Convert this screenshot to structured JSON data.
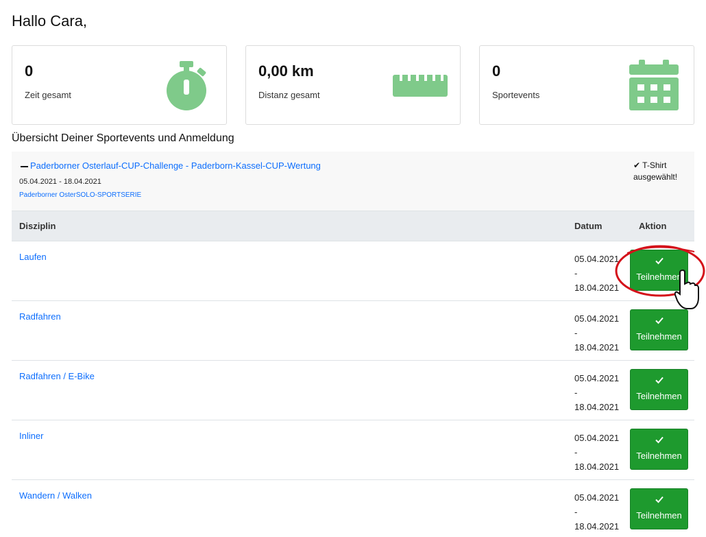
{
  "greeting": "Hallo Cara,",
  "stats": [
    {
      "value": "0",
      "label": "Zeit gesamt",
      "icon": "stopwatch-icon"
    },
    {
      "value": "0,00 km",
      "label": "Distanz gesamt",
      "icon": "ruler-icon"
    },
    {
      "value": "0",
      "label": "Sportevents",
      "icon": "calendar-icon"
    }
  ],
  "section_title": "Übersicht Deiner Sportevents und Anmeldung",
  "event": {
    "title": "Paderborner Osterlauf-CUP-Challenge - Paderborn-Kassel-CUP-Wertung",
    "dates": "05.04.2021 - 18.04.2021",
    "series": "Paderborner OsterSOLO-SPORTSERIE",
    "tshirt_line1": "✔ T-Shirt",
    "tshirt_line2": "ausgewählt!"
  },
  "table": {
    "headers": {
      "disziplin": "Disziplin",
      "datum": "Datum",
      "aktion": "Aktion"
    },
    "rows": [
      {
        "name": "Laufen",
        "date_from": "05.04.2021",
        "date_sep": "-",
        "date_to": "18.04.2021",
        "action": "Teilnehmen"
      },
      {
        "name": "Radfahren",
        "date_from": "05.04.2021",
        "date_sep": "-",
        "date_to": "18.04.2021",
        "action": "Teilnehmen"
      },
      {
        "name": "Radfahren / E-Bike",
        "date_from": "05.04.2021",
        "date_sep": "-",
        "date_to": "18.04.2021",
        "action": "Teilnehmen"
      },
      {
        "name": "Inliner",
        "date_from": "05.04.2021",
        "date_sep": "-",
        "date_to": "18.04.2021",
        "action": "Teilnehmen"
      },
      {
        "name": "Wandern / Walken",
        "date_from": "05.04.2021",
        "date_sep": "-",
        "date_to": "18.04.2021",
        "action": "Teilnehmen"
      }
    ]
  },
  "colors": {
    "icon_green": "#7fca8a",
    "button_green": "#1e9a2e",
    "link_blue": "#0d6efd",
    "highlight_red": "#d4111a"
  }
}
